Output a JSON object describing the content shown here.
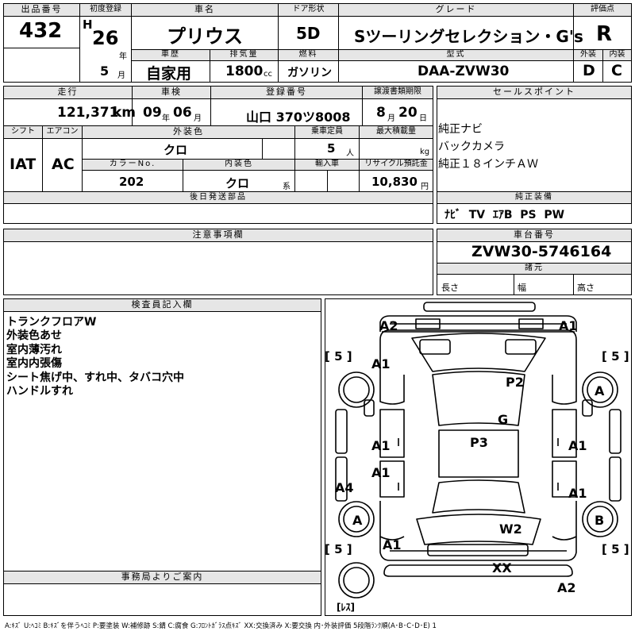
{
  "header": {
    "lot_no_label": "出品番号",
    "lot_no": "432",
    "first_reg_label": "初度登録",
    "first_reg_era": "H",
    "first_reg_year": "26",
    "year_unit": "年",
    "first_reg_month": "5",
    "month_unit": "月",
    "car_name_label": "車名",
    "car_name": "プリウス",
    "door_label": "ドア形状",
    "door": "5D",
    "grade_label": "グレード",
    "grade": "Sツーリングセレクション・G's",
    "score_label": "評価点",
    "score": "R",
    "history_label": "車歴",
    "history": "自家用",
    "displacement_label": "排気量",
    "displacement": "1800",
    "displacement_unit": "cc",
    "fuel_label": "燃料",
    "fuel": "ガソリン",
    "model_label": "型式",
    "model": "DAA-ZVW30",
    "exterior_label": "外装",
    "exterior": "D",
    "interior_label": "内装",
    "interior": "C"
  },
  "row2": {
    "mileage_label": "走行",
    "mileage": "121,371",
    "mileage_unit": "km",
    "inspection_label": "車検",
    "insp_year": "09",
    "insp_month": "06",
    "year_unit": "年",
    "month_unit": "月",
    "reg_no_label": "登録番号",
    "reg_no": "山口 370ツ8008",
    "transfer_label": "譲渡書類期限",
    "transfer_month": "8",
    "transfer_day": "20",
    "day_unit": "日",
    "month_unit2": "月",
    "shift_label": "シフト",
    "shift": "IAT",
    "ac_label": "エアコン",
    "ac": "AC",
    "ext_color_label": "外装色",
    "ext_color": "クロ",
    "capacity_label": "乗車定員",
    "capacity": "5",
    "capacity_unit": "人",
    "max_load_label": "最大積載量",
    "max_load_unit": "kg",
    "color_no_label": "カラーNo.",
    "color_no": "202",
    "int_color_label": "内装色",
    "int_color": "クロ",
    "int_color_unit": "系",
    "import_label": "輸入車",
    "recycle_label": "リサイクル預託金",
    "recycle": "10,830",
    "recycle_unit": "円",
    "later_parts_label": "後日発送部品"
  },
  "sales": {
    "label": "セールスポイント",
    "points": [
      "純正ナビ",
      "バックカメラ",
      "純正１８インチＡＷ"
    ]
  },
  "equipment": {
    "label": "純正装備",
    "items": "ﾅﾋﾞ  TV  ｴｱB  PS  PW"
  },
  "notes": {
    "label": "注意事項欄"
  },
  "chassis": {
    "label": "車台番号",
    "number": "ZVW30-5746164",
    "specs_label": "諸元",
    "length": "長さ",
    "width": "幅",
    "height": "高さ"
  },
  "inspector": {
    "label": "検査員記入欄",
    "lines": [
      "トランクフロアW",
      "外装色あせ",
      "室内薄汚れ",
      "室内内張傷",
      "シート焦げ中、すれ中、タバコ穴中",
      "ハンドルすれ"
    ]
  },
  "office": {
    "label": "事務局よりご案内"
  },
  "diagram": {
    "marks": {
      "a2_top": "A2",
      "a1_top_r": "A1",
      "a1_fl_fender": "A1",
      "p2": "P2",
      "a_fr_wheel": "A",
      "g": "G",
      "p3": "P3",
      "a1_fl_door": "A1",
      "a1_fr_door": "A1",
      "a1_rl_door": "A1",
      "a1_rr_door": "A1",
      "a4": "A4",
      "a_rl_wheel": "A",
      "b_rr_wheel": "B",
      "w2": "W2",
      "a1_rear_l": "A1",
      "xx": "XX",
      "a2_bottom": "A2"
    },
    "tire_fl": "[ 5 ]",
    "tire_fr": "[ 5 ]",
    "tire_rl": "[ 5 ]",
    "tire_rr": "[ 5 ]",
    "spare": "[ﾚｽ]"
  },
  "legend": "A:ｷｽﾞ U:ﾍｺﾐ B:ｷｽﾞを伴うﾍｺﾐ P:要塗装 W:補修跡 S:錆 C:腐食 G:ﾌﾛﾝﾄｶﾞﾗｽ点ｷｽﾞ XX:交換済み X:要交換  内･外装評価 5段階ﾗﾝｸ順(A･B･C･D･E) 1"
}
